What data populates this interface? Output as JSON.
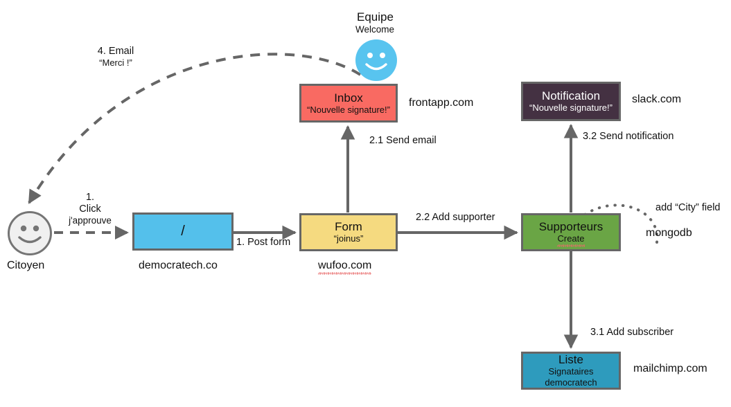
{
  "diagram": {
    "title_hidden": "",
    "actors": {
      "citoyen": {
        "icon": "smiley-face-icon",
        "caption": "Citoyen"
      },
      "equipe": {
        "icon": "smiley-face-icon",
        "label": "Equipe",
        "sublabel": "Welcome"
      }
    },
    "nodes": [
      {
        "id": "democratech",
        "title": "/",
        "sub": "",
        "caption": "democratech.co",
        "color": "#54c0eb"
      },
      {
        "id": "form",
        "title": "Form",
        "sub": "“joinus”",
        "caption": "wufoo.com",
        "caption_misspelled": true,
        "color": "#f5da80"
      },
      {
        "id": "inbox",
        "title": "Inbox",
        "sub": "“Nouvelle signature!”",
        "caption": "frontapp.com",
        "color": "#f96a62"
      },
      {
        "id": "notification",
        "title": "Notification",
        "sub": "“Nouvelle signature!”",
        "caption": "slack.com",
        "color": "#443142"
      },
      {
        "id": "supporteurs",
        "title": "Supporteurs",
        "sub": "Create",
        "sub_misspelled": true,
        "caption": "mongodb",
        "color": "#6aa545"
      },
      {
        "id": "liste",
        "title": "Liste",
        "sub": "Signataires",
        "sub2": "democratech",
        "caption": "mailchimp.com",
        "color": "#2e9bbd"
      }
    ],
    "edges": [
      {
        "id": "click",
        "line1": "1.",
        "line2": "Click",
        "line3": "j'approuve",
        "style": "dashed"
      },
      {
        "id": "post-form",
        "label": "1. Post form",
        "style": "solid"
      },
      {
        "id": "send-email",
        "label": "2.1 Send email",
        "style": "solid"
      },
      {
        "id": "add-supporter",
        "label": "2.2 Add supporter",
        "style": "solid"
      },
      {
        "id": "send-notification",
        "label": "3.2 Send notification",
        "style": "solid"
      },
      {
        "id": "add-subscriber",
        "label": "3.1 Add subscriber",
        "style": "solid"
      },
      {
        "id": "email-merci",
        "line1": "4. Email",
        "line2": "“Merci !”",
        "style": "dashed-curve"
      },
      {
        "id": "add-city-field",
        "label": "add “City” field",
        "style": "dotted-curve"
      }
    ],
    "colors": {
      "stroke": "#666666",
      "text": "#111111",
      "spellcheck_underline": "#e86a6a"
    }
  }
}
